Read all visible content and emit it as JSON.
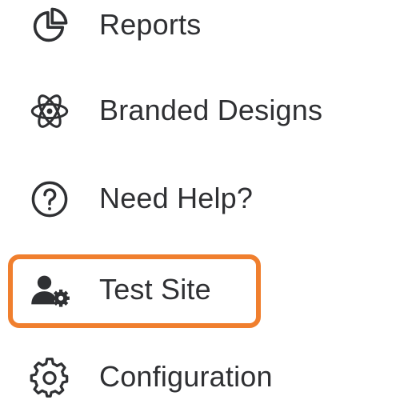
{
  "nav": {
    "items": [
      {
        "label": "Reports",
        "icon": "pie-chart-icon"
      },
      {
        "label": "Branded Designs",
        "icon": "atom-icon"
      },
      {
        "label": "Need Help?",
        "icon": "question-circle-icon"
      },
      {
        "label": "Test Site",
        "icon": "user-gear-icon"
      },
      {
        "label": "Configuration",
        "icon": "gear-icon"
      }
    ]
  },
  "highlight_color": "#f07f2e"
}
